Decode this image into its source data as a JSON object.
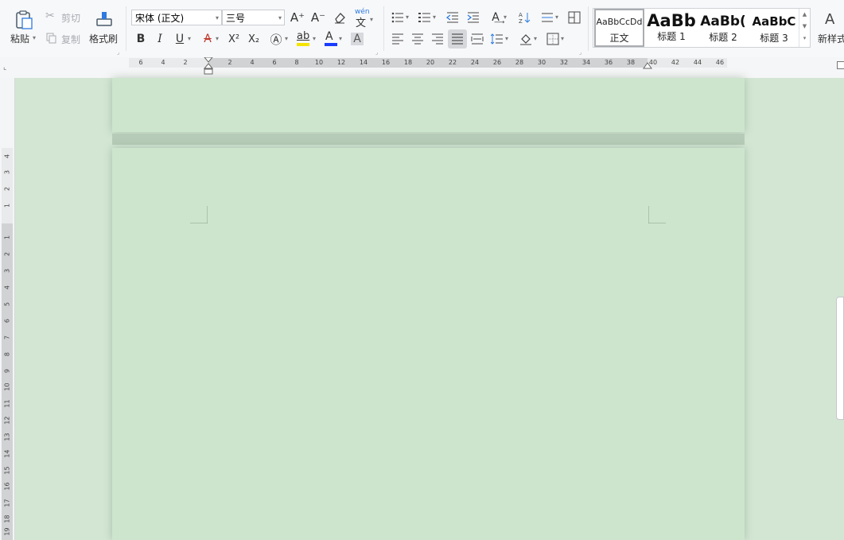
{
  "clipboard": {
    "paste": "粘贴",
    "cut": "剪切",
    "copy": "复制",
    "format_painter": "格式刷"
  },
  "font": {
    "family": "宋体 (正文)",
    "size": "三号",
    "bold": "B",
    "italic": "I",
    "underline": "U",
    "superscript": "X²",
    "subscript": "X₂",
    "highlight_letters": "ab",
    "font_color_letter": "A",
    "shade_letter": "A",
    "grow_label": "A⁺",
    "shrink_label": "A⁻",
    "phonetic_label": "wén"
  },
  "styles": {
    "items": [
      {
        "preview": "AaBbCcDd",
        "label": "正文"
      },
      {
        "preview": "AaBb",
        "label": "标题 1"
      },
      {
        "preview": "AaBb(",
        "label": "标题 2"
      },
      {
        "preview": "AaBbC",
        "label": "标题 3"
      }
    ],
    "new_style": "新样式"
  },
  "ruler": {
    "left_ticks": [
      "6",
      "4",
      "2"
    ],
    "ticks": [
      "2",
      "4",
      "6",
      "8",
      "10",
      "12",
      "14",
      "16",
      "18",
      "20",
      "22",
      "24",
      "26",
      "28",
      "30",
      "32",
      "34",
      "36",
      "38",
      "40",
      "42",
      "44",
      "46"
    ]
  },
  "vruler": {
    "top_ticks": [
      "4",
      "3",
      "2",
      "1"
    ],
    "ticks": [
      "1",
      "2",
      "3",
      "4",
      "5",
      "6",
      "7",
      "8",
      "9",
      "10",
      "11",
      "12",
      "13",
      "14",
      "15",
      "16",
      "17",
      "18",
      "19"
    ]
  },
  "colors": {
    "page_background": "#cde5cc",
    "workspace_background": "#d3e6d4",
    "highlight_color": "#f5e400",
    "font_color": "#1a3cff"
  }
}
